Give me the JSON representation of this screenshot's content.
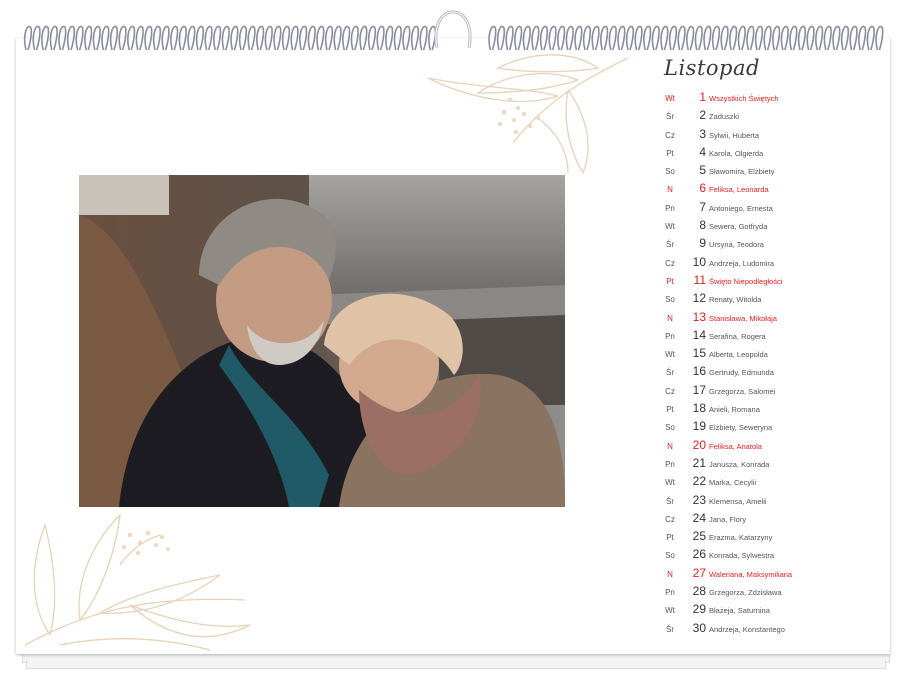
{
  "calendar": {
    "month": "Listopad",
    "colors": {
      "holiday": "#e02020",
      "text": "#333333",
      "leaf": "#e8d2b8"
    },
    "days": [
      {
        "dow": "Wt",
        "num": "1",
        "name": "Wszystkich Świętych",
        "holiday": true
      },
      {
        "dow": "Śr",
        "num": "2",
        "name": "Zaduszki",
        "holiday": false
      },
      {
        "dow": "Cz",
        "num": "3",
        "name": "Sylwii, Huberta",
        "holiday": false
      },
      {
        "dow": "Pt",
        "num": "4",
        "name": "Karola, Olgierda",
        "holiday": false
      },
      {
        "dow": "So",
        "num": "5",
        "name": "Sławomira, Elżbiety",
        "holiday": false
      },
      {
        "dow": "N",
        "num": "6",
        "name": "Feliksa, Leonarda",
        "holiday": true
      },
      {
        "dow": "Pn",
        "num": "7",
        "name": "Antoniego, Ernesta",
        "holiday": false
      },
      {
        "dow": "Wt",
        "num": "8",
        "name": "Sewera, Gotfryda",
        "holiday": false
      },
      {
        "dow": "Śr",
        "num": "9",
        "name": "Ursyna, Teodora",
        "holiday": false
      },
      {
        "dow": "Cz",
        "num": "10",
        "name": "Andrzeja, Ludomira",
        "holiday": false
      },
      {
        "dow": "Pt",
        "num": "11",
        "name": "Święto Niepodległości",
        "holiday": true
      },
      {
        "dow": "So",
        "num": "12",
        "name": "Renaty, Witolda",
        "holiday": false
      },
      {
        "dow": "N",
        "num": "13",
        "name": "Stanisława, Mikołaja",
        "holiday": true
      },
      {
        "dow": "Pn",
        "num": "14",
        "name": "Serafina, Rogera",
        "holiday": false
      },
      {
        "dow": "Wt",
        "num": "15",
        "name": "Alberta, Leopolda",
        "holiday": false
      },
      {
        "dow": "Śr",
        "num": "16",
        "name": "Gertrudy, Edmunda",
        "holiday": false
      },
      {
        "dow": "Cz",
        "num": "17",
        "name": "Grzegorza, Salomei",
        "holiday": false
      },
      {
        "dow": "Pt",
        "num": "18",
        "name": "Anieli, Romana",
        "holiday": false
      },
      {
        "dow": "So",
        "num": "19",
        "name": "Elżbiety, Seweryna",
        "holiday": false
      },
      {
        "dow": "N",
        "num": "20",
        "name": "Feliksa, Anatola",
        "holiday": true
      },
      {
        "dow": "Pn",
        "num": "21",
        "name": "Janusza, Konrada",
        "holiday": false
      },
      {
        "dow": "Wt",
        "num": "22",
        "name": "Marka, Cecylii",
        "holiday": false
      },
      {
        "dow": "Śr",
        "num": "23",
        "name": "Klemensa, Amelii",
        "holiday": false
      },
      {
        "dow": "Cz",
        "num": "24",
        "name": "Jana, Flory",
        "holiday": false
      },
      {
        "dow": "Pt",
        "num": "25",
        "name": "Erazma, Katarzyny",
        "holiday": false
      },
      {
        "dow": "So",
        "num": "26",
        "name": "Konrada, Sylwestra",
        "holiday": false
      },
      {
        "dow": "N",
        "num": "27",
        "name": "Waleriana, Maksymiliana",
        "holiday": true
      },
      {
        "dow": "Pn",
        "num": "28",
        "name": "Grzegorza, Zdzisława",
        "holiday": false
      },
      {
        "dow": "Wt",
        "num": "29",
        "name": "Błażeja, Saturnina",
        "holiday": false
      },
      {
        "dow": "Śr",
        "num": "30",
        "name": "Andrzeja, Konstantego",
        "holiday": false
      }
    ]
  },
  "photo": {
    "subject": "photo-elderly-couple"
  },
  "decoration": {
    "icon": "leaf-branch-icon"
  }
}
